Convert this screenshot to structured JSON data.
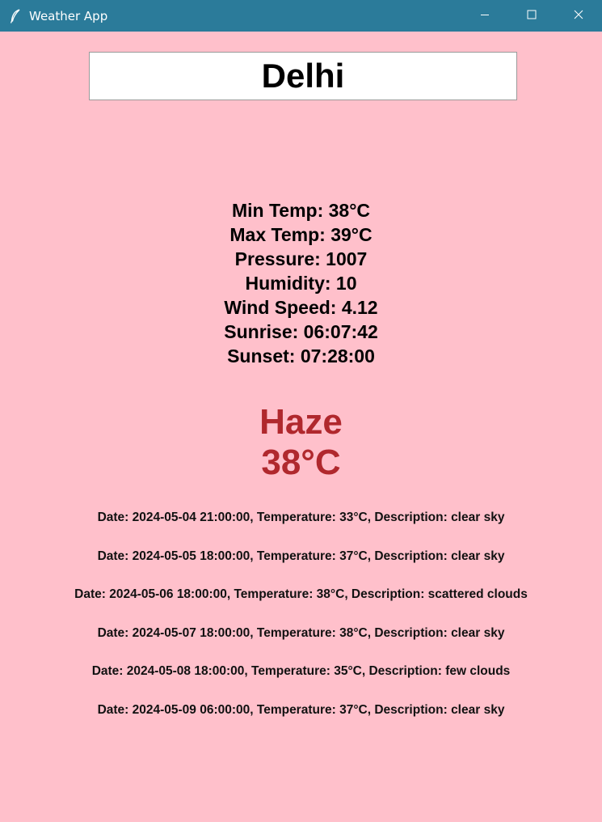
{
  "window": {
    "title": "Weather App",
    "icon": "feather-icon",
    "controls": [
      "minimize-icon",
      "maximize-icon",
      "close-icon"
    ],
    "title_bar_color": "#2b7b9a",
    "background_color": "#ffc0cb"
  },
  "search": {
    "value": "Delhi"
  },
  "details": {
    "min_temp": "Min Temp: 38°C",
    "max_temp": "Max Temp: 39°C",
    "pressure": "Pressure: 1007",
    "humidity": "Humidity: 10",
    "wind_speed": "Wind Speed: 4.12",
    "sunrise": "Sunrise: 06:07:42",
    "sunset": "Sunset: 07:28:00"
  },
  "current": {
    "condition": "Haze",
    "temperature": "38°C",
    "color": "#b0282d"
  },
  "forecast": [
    "Date: 2024-05-04 21:00:00, Temperature: 33°C, Description: clear sky",
    "Date: 2024-05-05 18:00:00, Temperature: 37°C, Description: clear sky",
    "Date: 2024-05-06 18:00:00, Temperature: 38°C, Description: scattered clouds",
    "Date: 2024-05-07 18:00:00, Temperature: 38°C, Description: clear sky",
    "Date: 2024-05-08 18:00:00, Temperature: 35°C, Description: few clouds",
    "Date: 2024-05-09 06:00:00, Temperature: 37°C, Description: clear sky"
  ]
}
